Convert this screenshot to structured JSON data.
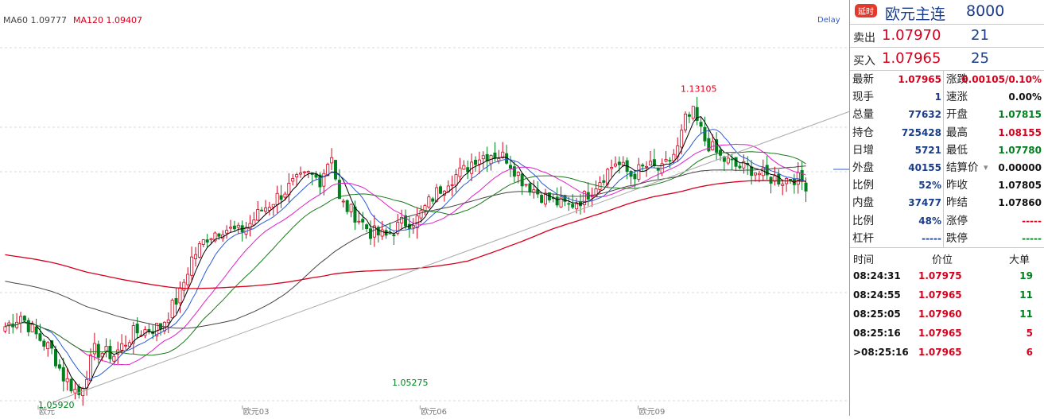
{
  "ma_legend": [
    {
      "name": "MA60",
      "value": "1.09777",
      "color": "#444444"
    },
    {
      "name": "MA120",
      "value": "1.09407",
      "color": "#d6001c"
    }
  ],
  "delay_label": "Delay",
  "colors": {
    "up": "#d6001c",
    "down": "#00801e",
    "ma5": "#000000",
    "ma10": "#2a5bd7",
    "ma20": "#e020c8",
    "ma30": "#1a7a1a",
    "ma60": "#444444",
    "ma120": "#d6001c",
    "trendline": "#aaaaaa"
  },
  "chart_data": {
    "type": "candlestick",
    "x_ticks": [
      "欧元",
      "欧元03",
      "欧元06",
      "欧元09"
    ],
    "x_tick_positions": [
      0.0,
      0.3,
      0.52,
      0.79
    ],
    "annotations": [
      {
        "text": "1.05920",
        "kind": "low",
        "color": "#00801e"
      },
      {
        "text": "1.05275",
        "kind": "low",
        "color": "#00801e"
      },
      {
        "text": "1.13105",
        "kind": "high",
        "color": "#d6001c"
      }
    ],
    "y_range": [
      1.0575,
      1.1445
    ],
    "price_path": [
      [
        0,
        1.0755
      ],
      [
        4,
        1.078
      ],
      [
        8,
        1.0735
      ],
      [
        12,
        1.07
      ],
      [
        15,
        1.064
      ],
      [
        19,
        1.06
      ],
      [
        23,
        1.07
      ],
      [
        28,
        1.069
      ],
      [
        33,
        1.074
      ],
      [
        40,
        1.0755
      ],
      [
        45,
        1.083
      ],
      [
        48,
        1.091
      ],
      [
        52,
        1.096
      ],
      [
        56,
        1.098
      ],
      [
        60,
        1.097
      ],
      [
        63,
        1.099
      ],
      [
        66,
        1.102
      ],
      [
        70,
        1.105
      ],
      [
        74,
        1.108
      ],
      [
        78,
        1.11
      ],
      [
        81,
        1.109
      ],
      [
        84,
        1.115
      ],
      [
        86,
        1.104
      ],
      [
        90,
        1.101
      ],
      [
        94,
        1.097
      ],
      [
        98,
        1.096
      ],
      [
        102,
        1.099
      ],
      [
        106,
        1.1
      ],
      [
        110,
        1.105
      ],
      [
        114,
        1.109
      ],
      [
        118,
        1.111
      ],
      [
        121,
        1.114
      ],
      [
        125,
        1.115
      ],
      [
        129,
        1.114
      ],
      [
        133,
        1.109
      ],
      [
        137,
        1.106
      ],
      [
        141,
        1.104
      ],
      [
        145,
        1.103
      ],
      [
        149,
        1.105
      ],
      [
        153,
        1.109
      ],
      [
        157,
        1.113
      ],
      [
        161,
        1.11
      ],
      [
        165,
        1.112
      ],
      [
        169,
        1.111
      ],
      [
        173,
        1.116
      ],
      [
        175,
        1.1225
      ],
      [
        177,
        1.124
      ],
      [
        180,
        1.118
      ],
      [
        184,
        1.114
      ],
      [
        188,
        1.112
      ],
      [
        192,
        1.1115
      ],
      [
        196,
        1.1095
      ],
      [
        200,
        1.109
      ],
      [
        203,
        1.1095
      ],
      [
        206,
        1.108
      ]
    ]
  },
  "side": {
    "badge": "延时",
    "title": "欧元主连",
    "code": "8000",
    "sell": {
      "label": "卖出",
      "price": "1.07970",
      "vol": "21"
    },
    "buy": {
      "label": "买入",
      "price": "1.07965",
      "vol": "25"
    },
    "left": [
      {
        "label": "最新",
        "value": "1.07965",
        "color": "red"
      },
      {
        "label": "现手",
        "value": "1",
        "color": "blue"
      },
      {
        "label": "总量",
        "value": "77632",
        "color": "blue"
      },
      {
        "label": "持仓",
        "value": "725428",
        "color": "blue"
      },
      {
        "label": "日增",
        "value": "5721",
        "color": "blue"
      },
      {
        "label": "外盘",
        "value": "40155",
        "color": "blue"
      },
      {
        "label": "比例",
        "value": "52%",
        "color": "blue"
      },
      {
        "label": "内盘",
        "value": "37477",
        "color": "blue"
      },
      {
        "label": "比例",
        "value": "48%",
        "color": "blue"
      },
      {
        "label": "杠杆",
        "value": "-----",
        "color": "blue"
      }
    ],
    "right": [
      {
        "label": "涨跌",
        "value": "0.00105/0.10%",
        "color": "red"
      },
      {
        "label": "速涨",
        "value": "0.00%",
        "color": "black"
      },
      {
        "label": "开盘",
        "value": "1.07815",
        "color": "green"
      },
      {
        "label": "最高",
        "value": "1.08155",
        "color": "red"
      },
      {
        "label": "最低",
        "value": "1.07780",
        "color": "green"
      },
      {
        "label": "结算价",
        "value": "0.00000",
        "color": "black"
      },
      {
        "label": "昨收",
        "value": "1.07805",
        "color": "black"
      },
      {
        "label": "昨结",
        "value": "1.07860",
        "color": "black"
      },
      {
        "label": "涨停",
        "value": "-----",
        "color": "red"
      },
      {
        "label": "跌停",
        "value": "-----",
        "color": "green"
      }
    ],
    "trades_header": {
      "time": "时间",
      "price": "价位",
      "vol": "大单"
    },
    "trades": [
      {
        "time": "08:24:31",
        "price": "1.07975",
        "vol": "19",
        "color": "green"
      },
      {
        "time": "08:24:55",
        "price": "1.07965",
        "vol": "11",
        "color": "green"
      },
      {
        "time": "08:25:05",
        "price": "1.07960",
        "vol": "11",
        "color": "green"
      },
      {
        "time": "08:25:16",
        "price": "1.07965",
        "vol": "5",
        "color": "red"
      },
      {
        "time": ">08:25:16",
        "price": "1.07965",
        "vol": "6",
        "color": "red"
      }
    ]
  }
}
